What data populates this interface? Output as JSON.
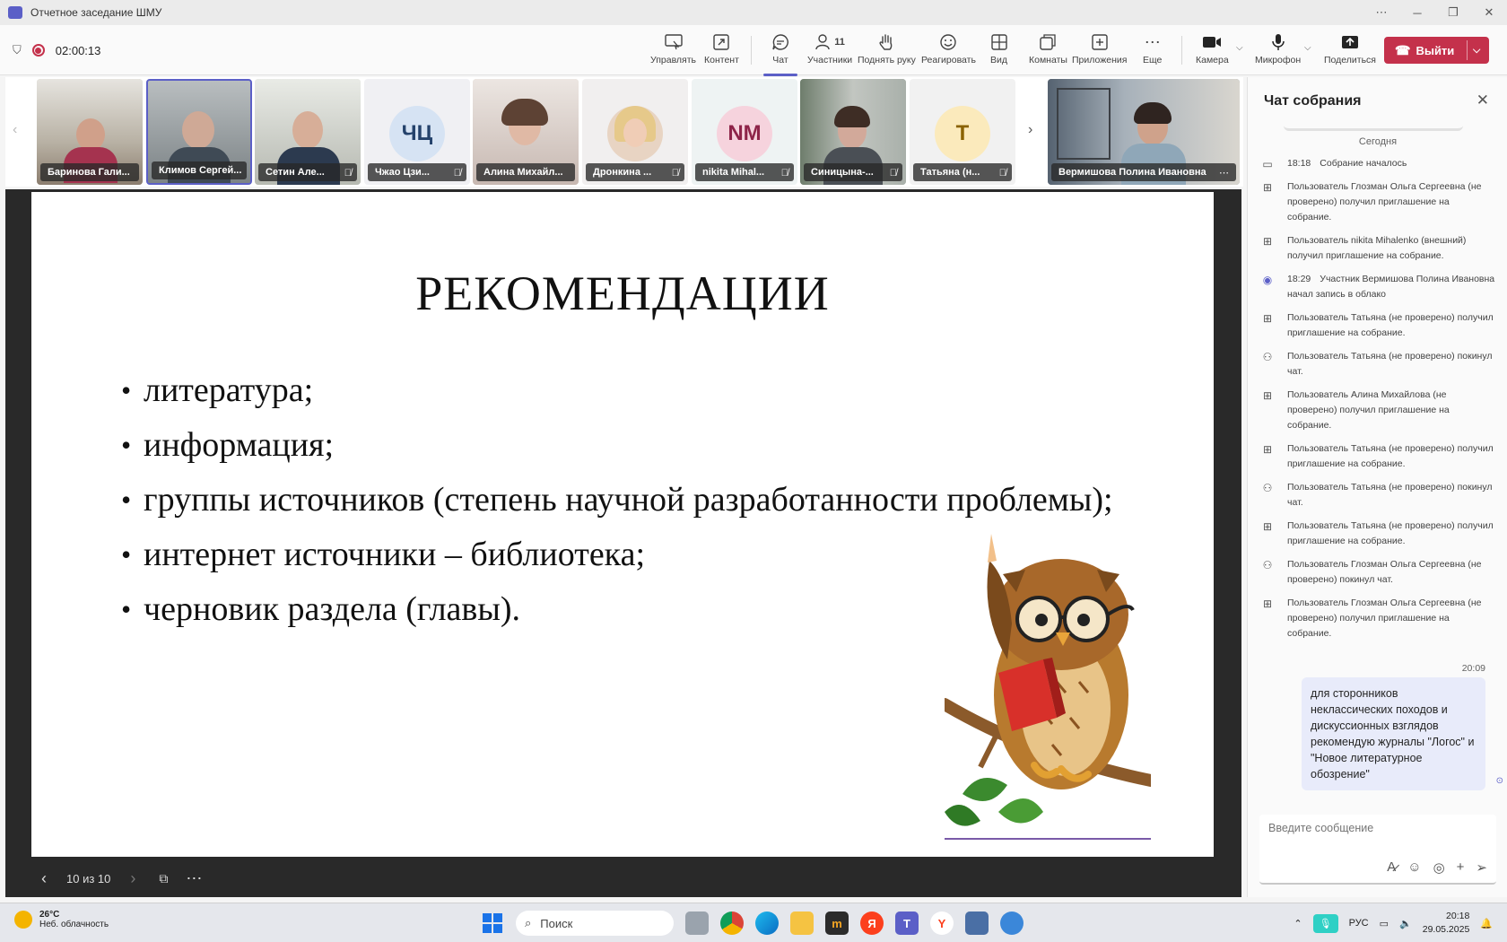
{
  "window": {
    "title": "Отчетное заседание ШМУ"
  },
  "toolbar": {
    "timer": "02:00:13",
    "participants_count": "11",
    "items": {
      "manage": "Управлять",
      "content": "Контент",
      "chat": "Чат",
      "participants": "Участники",
      "raise_hand": "Поднять руку",
      "react": "Реагировать",
      "view": "Вид",
      "rooms": "Комнаты",
      "apps": "Приложения",
      "more": "Еще",
      "camera": "Камера",
      "mic": "Микрофон",
      "share": "Поделиться"
    },
    "leave": "Выйти"
  },
  "participants": [
    {
      "name": "Баринова Гали...",
      "type": "video",
      "muted": false
    },
    {
      "name": "Климов Сергей...",
      "type": "video",
      "muted": false,
      "active": true
    },
    {
      "name": "Сетин Але...",
      "type": "video",
      "muted": true
    },
    {
      "name": "Чжао Цзи...",
      "type": "initials",
      "initials": "ЧЦ",
      "muted": true
    },
    {
      "name": "Алина Михайл...",
      "type": "video",
      "muted": false
    },
    {
      "name": "Дронкина ...",
      "type": "photo",
      "muted": true
    },
    {
      "name": "nikita Mihal...",
      "type": "initials",
      "initials": "NM",
      "muted": true
    },
    {
      "name": "Синицына-...",
      "type": "video",
      "muted": true
    },
    {
      "name": "Татьяна (н...",
      "type": "initials",
      "initials": "Т",
      "muted": true
    },
    {
      "name": "Вермишова Полина Ивановна",
      "type": "video",
      "muted": false
    }
  ],
  "slide": {
    "title": "РЕКОМЕНДАЦИИ",
    "bullets": [
      "литература;",
      "информация;",
      "группы источников (степень научной разработанности проблемы);",
      "интернет источники – библиотека;",
      "черновик раздела (главы)."
    ],
    "counter": "10 из 10"
  },
  "chat": {
    "title": "Чат собрания",
    "date_divider": "Сегодня",
    "events": [
      {
        "icon": "camera-icon",
        "time": "18:18",
        "text": "Собрание началось"
      },
      {
        "icon": "invite-icon",
        "time": "",
        "text": "Пользователь Глозман Ольга Сергеевна (не проверено) получил приглашение на собрание."
      },
      {
        "icon": "invite-icon",
        "time": "",
        "text": "Пользователь nikita Mihalenko (внешний) получил приглашение на собрание."
      },
      {
        "icon": "record-icon",
        "time": "18:29",
        "text": "Участник Вермишова Полина Ивановна начал запись в облако"
      },
      {
        "icon": "invite-icon",
        "time": "",
        "text": "Пользователь Татьяна (не проверено) получил приглашение на собрание."
      },
      {
        "icon": "person-left-icon",
        "time": "",
        "text": "Пользователь Татьяна (не проверено) покинул чат."
      },
      {
        "icon": "invite-icon",
        "time": "",
        "text": "Пользователь Алина Михайлова (не проверено) получил приглашение на собрание."
      },
      {
        "icon": "invite-icon",
        "time": "",
        "text": "Пользователь Татьяна (не проверено) получил приглашение на собрание."
      },
      {
        "icon": "person-left-icon",
        "time": "",
        "text": "Пользователь Татьяна (не проверено) покинул чат."
      },
      {
        "icon": "invite-icon",
        "time": "",
        "text": "Пользователь Татьяна (не проверено) получил приглашение на собрание."
      },
      {
        "icon": "person-left-icon",
        "time": "",
        "text": "Пользователь Глозман Ольга Сергеевна (не проверено) покинул чат."
      },
      {
        "icon": "invite-icon",
        "time": "",
        "text": "Пользователь Глозман Ольга Сергеевна (не проверено) получил приглашение на собрание."
      }
    ],
    "message": {
      "time": "20:09",
      "text": "для сторонников неклассических походов и дискуссионных взглядов рекомендую журналы \"Логос\" и \"Новое литературное обозрение\""
    },
    "input_placeholder": "Введите сообщение"
  },
  "taskbar": {
    "weather_temp": "26°C",
    "weather_desc": "Неб. облачность",
    "search_placeholder": "Поиск",
    "lang": "РУС",
    "time": "20:18",
    "date": "29.05.2025"
  },
  "colors": {
    "accent": "#5b5fc7",
    "leave": "#c4314b",
    "stage": "#292929",
    "bubble": "#e8ebfa"
  }
}
